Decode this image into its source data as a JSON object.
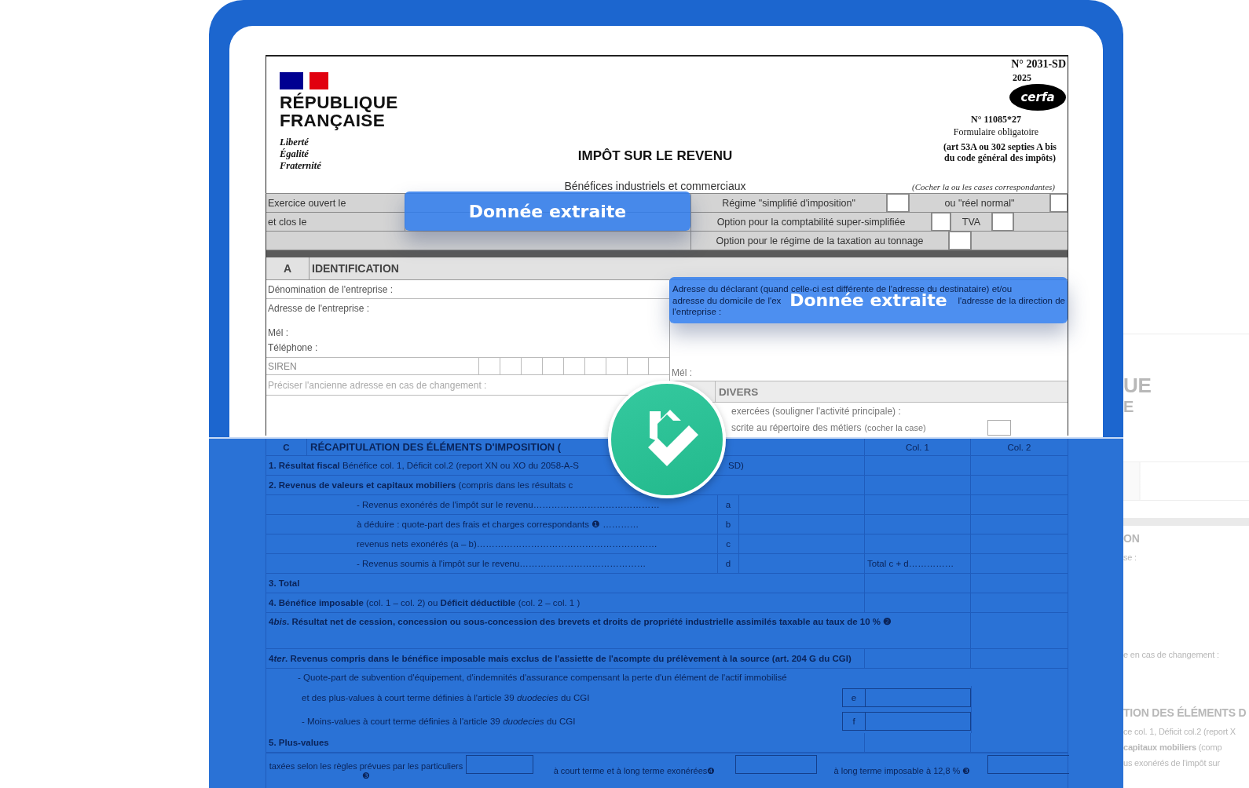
{
  "form": {
    "logo": {
      "name": "RÉPUBLIQUE FRANÇAISE",
      "motto": [
        "Liberté",
        "Égalité",
        "Fraternité"
      ]
    },
    "title": "IMPÔT SUR LE REVENU",
    "subtitle": "Bénéfices industriels et commerciaux",
    "form_number": "N° 2031-SD",
    "year": "2025",
    "cerfa": "cerfa",
    "cerfa_number": "N° 11085*27",
    "mandatory": "Formulaire obligatoire",
    "legal_ref": "(art 53A ou 302 septies A bis du code général des impôts)",
    "check_hint": "(Cocher la ou les cases correspondantes)",
    "period": [
      "Exercice ouvert le",
      "et clos le"
    ],
    "options": [
      {
        "label": "Régime \"simplifié d'imposition\"",
        "checked": false
      },
      {
        "label": "ou \"réel normal\"",
        "checked": false
      },
      {
        "label": "Option pour la comptabilité super-simplifiée",
        "checked": false
      },
      {
        "label": "TVA",
        "checked": false
      },
      {
        "label": "Option pour le régime de la taxation au tonnage",
        "checked": false
      }
    ],
    "section_a": {
      "letter": "A",
      "title": "IDENTIFICATION",
      "left": [
        "Dénomination de l'entreprise :",
        "Adresse de l'entreprise :",
        "Mél :",
        "Téléphone :",
        "SIREN",
        "Préciser l'ancienne adresse en cas de changement :"
      ],
      "declarant": [
        "Adresse du déclarant (quand celle-ci est différente de l'adresse du destinataire) et/ou",
        "adresse du domicile de l'ex",
        "l'adresse de la direction de",
        "l'entreprise :"
      ],
      "right_mail": "Mél :"
    },
    "section_b": {
      "title": "DIVERS",
      "lines": [
        "exercées (souligner l'activité principale) :",
        "scrite au répertoire des métiers"
      ],
      "hint": "(cocher la case)",
      "checked": false
    },
    "section_c": {
      "letter": "C",
      "title": "RÉCAPITULATION DES ÉLÉMENTS D'IMPOSITION (",
      "columns": [
        "Col. 1",
        "Col. 2"
      ],
      "rows": [
        {
          "kind": "line",
          "text": "**1. Résultat fiscal**    Bénéfice col. 1, Déficit col.2 (report XN ou XO du 2058-A-S",
          "after": "SD)"
        },
        {
          "kind": "line",
          "text": "**2. Revenus de valeurs et capitaux mobiliers** (compris dans les résultats c"
        },
        {
          "kind": "sub",
          "text": "- Revenus exonérés de l'impôt sur le revenu……………………………………",
          "letter": "a"
        },
        {
          "kind": "sub",
          "text": "à déduire : quote-part des frais et charges correspondants  ❶ …………",
          "letter": "b"
        },
        {
          "kind": "sub",
          "text": "revenus nets exonérés (a – b)……………………………………………………",
          "letter": "c"
        },
        {
          "kind": "sub",
          "text": "- Revenus soumis à l'impôt sur le revenu……………………………………",
          "letter": "d",
          "total": "Total c + d……………"
        },
        {
          "kind": "bold",
          "text": "3. Total"
        },
        {
          "kind": "line",
          "text": "**4. Bénéfice imposable** (col. 1 – col. 2) ou **Déficit déductible** (col. 2 – col. 1 )"
        },
        {
          "kind": "para",
          "parts": [
            "4",
            "bis",
            ". Résultat net de cession, concession ou sous-concession des brevets et droits de propriété industrielle assimilés taxable au taux de 10 % ❷"
          ]
        },
        {
          "kind": "bold",
          "parts": [
            "4",
            "ter",
            ". Revenus compris dans le bénéfice imposable mais exclus de l'assiette de l'acompte du prélèvement à la source (art. 204 G du CGI)"
          ]
        },
        {
          "kind": "note",
          "text": "- Quote-part de subvention d'équipement, d'indemnités d'assurance compensant la perte d'un élément de l'actif immobilisé"
        },
        {
          "kind": "entry",
          "parts": [
            "et des plus-values à court terme définies à l'article 39",
            "duodecies",
            "du CGI"
          ],
          "letter": "e"
        },
        {
          "kind": "entry",
          "parts": [
            "- Moins-values à court terme définies à l'article 39",
            "duodecies",
            "du CGI"
          ],
          "letter": "f"
        },
        {
          "kind": "bold",
          "text": "5. Plus-values"
        },
        {
          "kind": "triple",
          "parts": [
            "taxées selon les règles prévues par les particuliers ❸",
            "à court terme et à long terme exonérées❹",
            "à long terme imposable à 12,8 % ❸"
          ]
        }
      ]
    }
  },
  "chips": [
    {
      "text": "Donnée extraite"
    },
    {
      "text": "Donnée extraite"
    }
  ],
  "ghost": [
    "UE",
    "E",
    "ON",
    "se :",
    "e en cas de changement :",
    "TION DES ÉLÉMENTS D",
    "ce col. 1, Déficit col.2 (report X",
    "**capitaux mobiliers** (comp",
    "us exonérés de l'impôt sur"
  ]
}
